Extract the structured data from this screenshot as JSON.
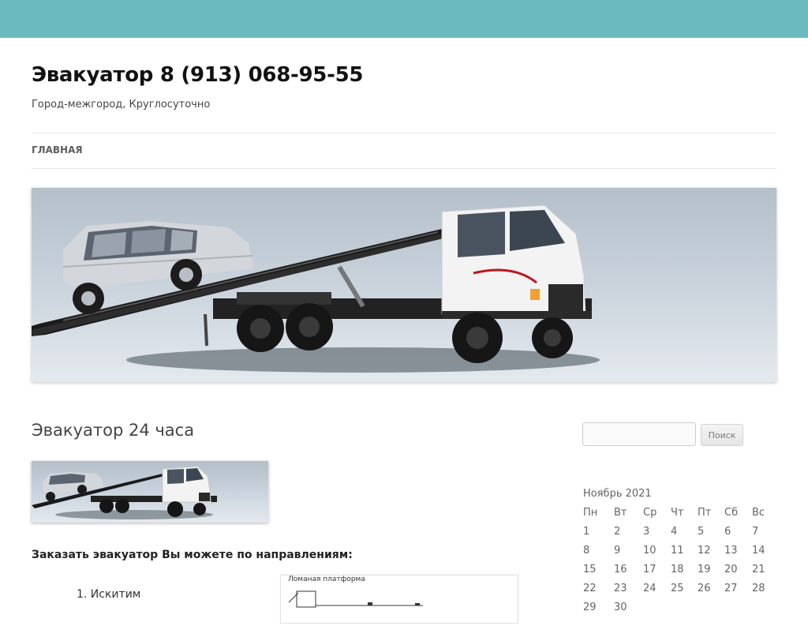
{
  "header": {
    "site_title": "Эвакуатор 8 (913) 068-95-55",
    "site_description": "Город-межгород, Круглосуточно"
  },
  "nav": {
    "items": [
      {
        "label": "ГЛАВНАЯ"
      }
    ]
  },
  "hero": {
    "image": "tow-truck-with-suv-image",
    "colors": {
      "background_top": "#b4bfca",
      "background_bottom": "#e4e9ee",
      "topbar": "#6bbac0"
    }
  },
  "post": {
    "title": "Эвакуатор 24 часа",
    "thumbnail": "tow-truck-thumbnail-image",
    "order_text": "Заказать эвакуатор Вы можете по направлениям:",
    "directions": [
      {
        "label": "1. Искитим"
      }
    ],
    "diagram": {
      "label": "Ломаная платформа"
    }
  },
  "sidebar": {
    "search": {
      "placeholder": "",
      "value": "",
      "button_label": "Поиск"
    },
    "calendar": {
      "caption": "Ноябрь 2021",
      "weekdays": [
        "Пн",
        "Вт",
        "Ср",
        "Чт",
        "Пт",
        "Сб",
        "Вс"
      ],
      "weeks": [
        [
          "1",
          "2",
          "3",
          "4",
          "5",
          "6",
          "7"
        ],
        [
          "8",
          "9",
          "10",
          "11",
          "12",
          "13",
          "14"
        ],
        [
          "15",
          "16",
          "17",
          "18",
          "19",
          "20",
          "21"
        ],
        [
          "22",
          "23",
          "24",
          "25",
          "26",
          "27",
          "28"
        ],
        [
          "29",
          "30",
          "",
          "",
          "",
          "",
          ""
        ]
      ]
    }
  }
}
